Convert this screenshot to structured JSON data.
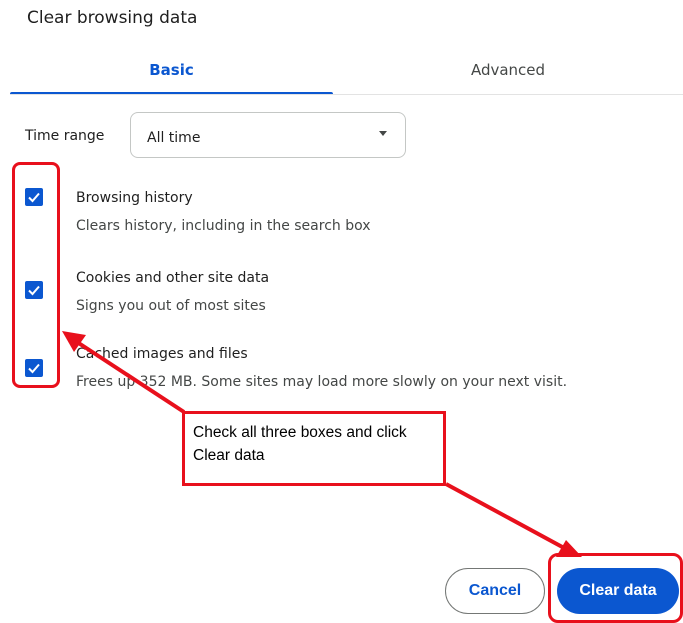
{
  "dialog": {
    "title": "Clear browsing data"
  },
  "tabs": [
    {
      "label": "Basic",
      "active": true
    },
    {
      "label": "Advanced",
      "active": false
    }
  ],
  "time_range": {
    "label": "Time range",
    "value": "All time"
  },
  "options": [
    {
      "title": "Browsing history",
      "description": "Clears history, including in the search box",
      "checked": true
    },
    {
      "title": "Cookies and other site data",
      "description": "Signs you out of most sites",
      "checked": true
    },
    {
      "title": "Cached images and files",
      "description": "Frees up 352 MB. Some sites may load more slowly on your next visit.",
      "checked": true
    }
  ],
  "buttons": {
    "cancel": "Cancel",
    "clear": "Clear data"
  },
  "annotation": {
    "note": "Check all three boxes and click Clear data",
    "color": "#e8101c"
  },
  "colors": {
    "accent": "#0b57d0"
  },
  "icons": {
    "checkbox_check": "check-icon",
    "dropdown": "chevron-down-icon"
  }
}
